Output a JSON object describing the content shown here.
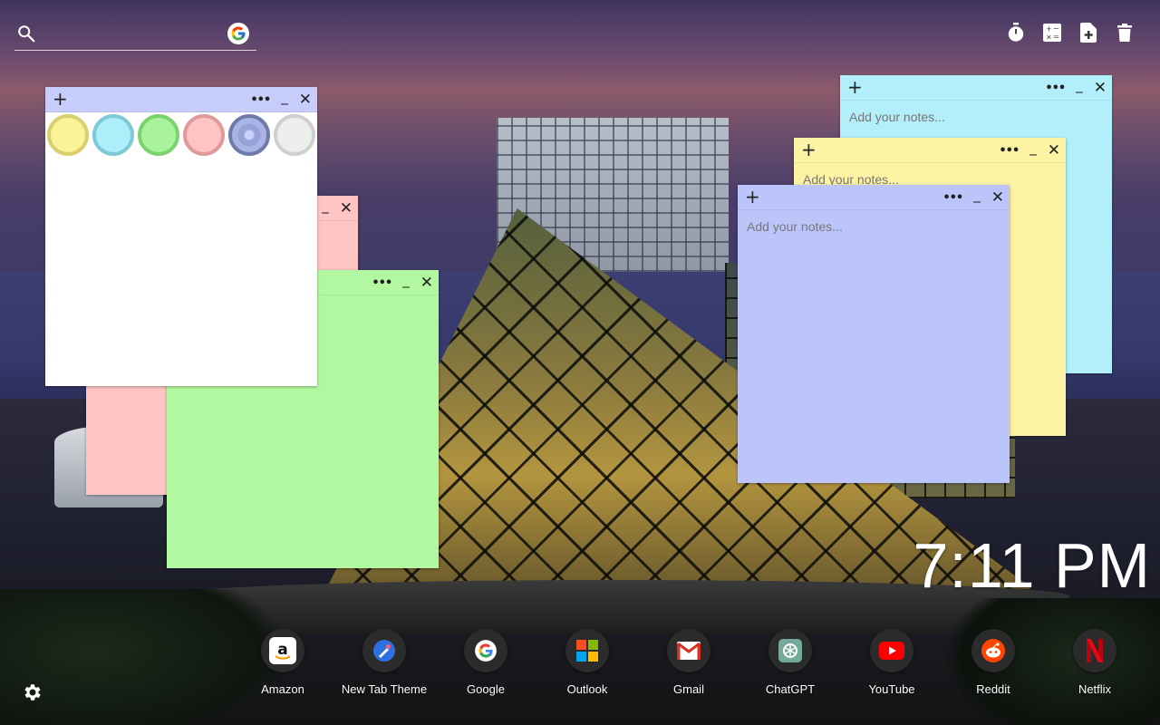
{
  "search": {
    "value": "",
    "placeholder": "",
    "icon": "search-icon",
    "engine_icon": "google-icon"
  },
  "toolbar": {
    "buttons": [
      {
        "icon": "stopwatch-icon"
      },
      {
        "icon": "calculator-icon"
      },
      {
        "icon": "add-note-icon"
      },
      {
        "icon": "trash-icon"
      }
    ]
  },
  "notes": {
    "placeholder": "Add your notes...",
    "controls": {
      "add": "+",
      "more": "•••",
      "minimize": "_",
      "close": "✕"
    },
    "colors": {
      "white": "#ffffff",
      "pink": "#ffc5c5",
      "green": "#b2f8a0",
      "cyan": "#b3eefb",
      "yellow": "#fdf3a4",
      "blue": "#bcc5f9"
    },
    "color_picker": [
      {
        "name": "yellow",
        "fill": "#fbf39a",
        "ring": "#d9cf6c"
      },
      {
        "name": "cyan",
        "fill": "#aeeefb",
        "ring": "#7ec9d6"
      },
      {
        "name": "green",
        "fill": "#a8f39c",
        "ring": "#7cd26c"
      },
      {
        "name": "pink",
        "fill": "#ffc3c3",
        "ring": "#e09a9a"
      },
      {
        "name": "blue",
        "fill": "#97a3d8",
        "ring": "#6e7aa8",
        "selected": true
      },
      {
        "name": "white",
        "fill": "#eeeeee",
        "ring": "#cfcfcf"
      }
    ]
  },
  "clock": {
    "time": "7:11 PM"
  },
  "shortcuts": [
    {
      "label": "Amazon",
      "icon": "amazon-icon"
    },
    {
      "label": "New Tab Theme",
      "icon": "new-tab-theme-icon"
    },
    {
      "label": "Google",
      "icon": "google-icon"
    },
    {
      "label": "Outlook",
      "icon": "microsoft-icon"
    },
    {
      "label": "Gmail",
      "icon": "gmail-icon"
    },
    {
      "label": "ChatGPT",
      "icon": "chatgpt-icon"
    },
    {
      "label": "YouTube",
      "icon": "youtube-icon"
    },
    {
      "label": "Reddit",
      "icon": "reddit-icon"
    },
    {
      "label": "Netflix",
      "icon": "netflix-icon"
    }
  ],
  "settings": {
    "icon": "gear-icon"
  }
}
